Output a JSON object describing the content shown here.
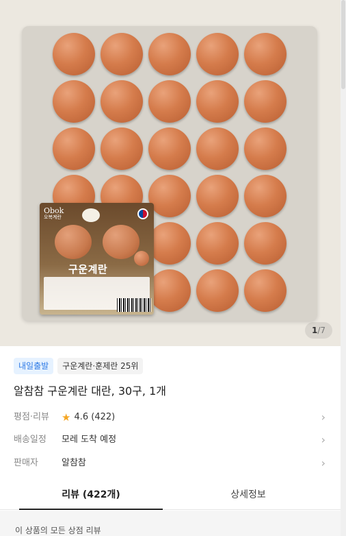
{
  "gallery": {
    "current": "1",
    "separator": "/",
    "total": "7"
  },
  "badges": {
    "delivery": "내일출발",
    "ranking": "구운계란·훈제란 25위"
  },
  "product": {
    "title": "알참참 구운계란 대란, 30구, 1개"
  },
  "package_label": {
    "brand_latin": "Obok",
    "brand_korean": "오복계란",
    "product_name": "구운계란"
  },
  "info": {
    "rating_label": "평점·리뷰",
    "rating_value": "4.6 (422)",
    "delivery_label": "배송일정",
    "delivery_value": "모레 도착 예정",
    "seller_label": "판매자",
    "seller_value": "알참참"
  },
  "tabs": {
    "reviews": "리뷰 (422개)",
    "details": "상세정보"
  },
  "reviews": {
    "heading": "이 상품의 모든 상점 리뷰"
  },
  "colors": {
    "accent_blue": "#2f7be6",
    "star": "#f5a623",
    "egg": "#d57c4c"
  }
}
